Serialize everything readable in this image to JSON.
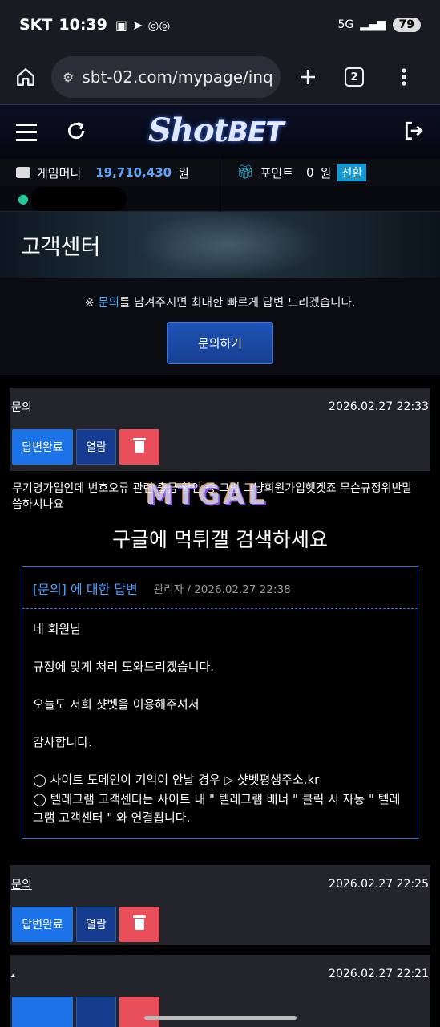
{
  "status": {
    "carrier": "SKT",
    "time": "10:39",
    "network": "5G",
    "battery": "79"
  },
  "browser": {
    "url": "sbt-02.com/mypage/inq",
    "tab_count": "2"
  },
  "site": {
    "logo_shot": "Shot",
    "logo_bet": "BET",
    "game_money_label": "게임머니",
    "game_money_value": "19,710,430",
    "currency": "원",
    "point_label": "포인트",
    "point_value": "0",
    "point_currency": "원",
    "convert_label": "전환"
  },
  "banner": {
    "title": "고객센터"
  },
  "notice": {
    "prefix": "※ ",
    "highlight": "문의",
    "suffix": "를 남겨주시면 최대한 빠르게 답변 드리겠습니다.",
    "button": "문의하기"
  },
  "posts": [
    {
      "type": "문의",
      "date": "2026.02.27 22:33",
      "btn_done": "답변완료",
      "btn_view": "열람",
      "question": "무기명가입인데 번호오류 관련 출금 확인 중 그럼 그냥회원가입햇겟죠 무슨규정위반말씀하시나요",
      "watermark": "MTGAL",
      "promo": "구글에 먹튀갤 검색하세요",
      "answer": {
        "title": "[문의] 에 대한 답변",
        "meta": "관리자 / 2026.02.27 22:38",
        "lines": [
          "네 회원님",
          "규정에 맞게 처리 도와드리겠습니다.",
          "오늘도 저희 샷벳을 이용해주셔서",
          "감사합니다.",
          "◯ 사이트 도메인이 기억이 안날 경우 ▷ 샷벳평생주소.kr",
          "◯ 텔레그램 고객센터는 사이트 내 \" 텔레그램 배너 \" 클릭 시 자동 \" 텔레그램 고객센터 \" 와 연결됩니다."
        ]
      }
    },
    {
      "type": "문의",
      "date": "2026.02.27 22:25",
      "btn_done": "답변완료",
      "btn_view": "열람"
    },
    {
      "type": ".",
      "date": "2026.02.27 22:21"
    }
  ]
}
